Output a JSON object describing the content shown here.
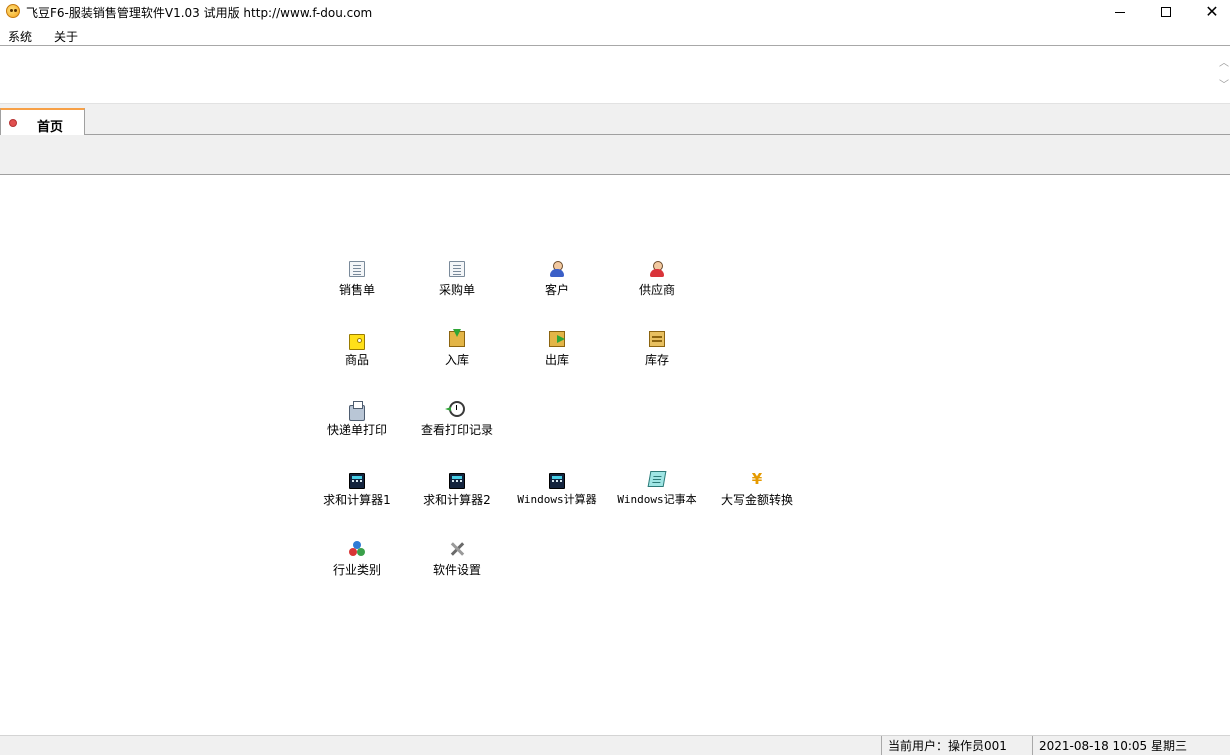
{
  "window": {
    "title": "飞豆F6-服装销售管理软件V1.03 试用版 http://www.f-dou.com",
    "minimize_icon": "minimize-icon",
    "maximize_icon": "maximize-icon",
    "close_glyph": "✕"
  },
  "menu": {
    "items": [
      {
        "label": "系统"
      },
      {
        "label": "关于"
      }
    ]
  },
  "tabs": [
    {
      "label": "首页",
      "active": true
    }
  ],
  "launchers": [
    {
      "label": "销售单",
      "icon": "sales-order-icon"
    },
    {
      "label": "采购单",
      "icon": "purchase-order-icon"
    },
    {
      "label": "客户",
      "icon": "customer-icon"
    },
    {
      "label": "供应商",
      "icon": "supplier-icon"
    },
    {
      "label": "商品",
      "icon": "product-tag-icon"
    },
    {
      "label": "入库",
      "icon": "stock-in-icon"
    },
    {
      "label": "出库",
      "icon": "stock-out-icon"
    },
    {
      "label": "库存",
      "icon": "inventory-icon"
    },
    {
      "label": "快递单打印",
      "icon": "printer-icon"
    },
    {
      "label": "查看打印记录",
      "icon": "history-icon"
    },
    {
      "label": "求和计算器1",
      "icon": "calculator-icon"
    },
    {
      "label": "求和计算器2",
      "icon": "calculator-icon"
    },
    {
      "label": "Windows计算器",
      "icon": "calculator-icon"
    },
    {
      "label": "Windows记事本",
      "icon": "notepad-icon"
    },
    {
      "label": "大写金额转换",
      "icon": "yen-icon",
      "glyph": "¥"
    },
    {
      "label": "行业类别",
      "icon": "category-icon"
    },
    {
      "label": "软件设置",
      "icon": "tools-icon"
    }
  ],
  "status": {
    "user": "当前用户：操作员001",
    "datetime": "2021-08-18 10:05 星期三"
  },
  "colors": {
    "tab_accent": "#f7a046",
    "chrome_bg": "#f0f0f0"
  }
}
